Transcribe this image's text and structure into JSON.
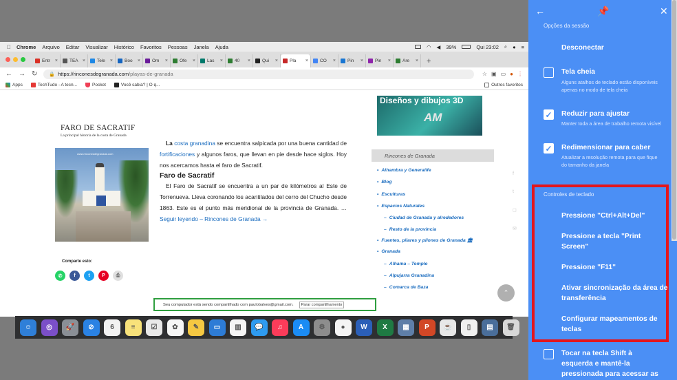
{
  "menubar": {
    "items": [
      "Chrome",
      "Arquivo",
      "Editar",
      "Visualizar",
      "Histórico",
      "Favoritos",
      "Pessoas",
      "Janela",
      "Ajuda"
    ],
    "battery": "39%",
    "clock": "Qui 23:02"
  },
  "tabs": [
    {
      "label": "Entr",
      "color": "#d93025"
    },
    {
      "label": "TEA",
      "color": "#555555"
    },
    {
      "label": "Tele",
      "color": "#1e88e5"
    },
    {
      "label": "Boo",
      "color": "#1565c0"
    },
    {
      "label": "Om",
      "color": "#6a1b9a"
    },
    {
      "label": "Ofe",
      "color": "#2e7d32"
    },
    {
      "label": "Las",
      "color": "#00796b"
    },
    {
      "label": "40",
      "color": "#2e7d32"
    },
    {
      "label": "Qui",
      "color": "#222222"
    },
    {
      "label": "Pla",
      "color": "#c62828"
    },
    {
      "label": "CO",
      "color": "#4285f4"
    },
    {
      "label": "Pin",
      "color": "#1976d2"
    },
    {
      "label": "Pin",
      "color": "#8e24aa"
    },
    {
      "label": "Áre",
      "color": "#2e7d32"
    }
  ],
  "url": {
    "host": "https://rinconesdegranada.com",
    "path": "/playas-de-granada"
  },
  "bookmarks": {
    "items": [
      "Apps",
      "TechTudo - A tecn...",
      "Pocket",
      "Você sabia? | O q..."
    ],
    "other": "Outros favoritos"
  },
  "article": {
    "title": "FARO DE SACRATIF",
    "subtitle": "La principal historia de la costa de Granada",
    "photo_caption": "www.rinconesdegranada.com",
    "p1_bold": "La",
    "p1_link1": "costa granadina",
    "p1_mid": " se encuentra salpicada por una buena cantidad de ",
    "p1_link2": "fortificaciones",
    "p1_end": " y algunos faros, que llevan en pie desde hace siglos. Hoy nos acercamos hasta el faro de Sacratif.",
    "heading": "Faro de Sacratif",
    "p2": "El Faro de Sacratif se encuentra a un par de kilómetros al Este de Torrenueva. Lleva coronando los acantilados del cerro del Chucho desde 1863. Este es el punto más meridional de la provincia de Granada. … ",
    "readmore": "Seguir leyendo – Rincones de Granada →",
    "share_label": "Comparte esto:"
  },
  "sidebar": {
    "banner": "Diseños y dibujos 3D",
    "banner_logo": "AM",
    "widget_title": "Rincones de Granada",
    "categories": [
      {
        "label": "Alhambra y Generalife",
        "sub": false
      },
      {
        "label": "Blog",
        "sub": false
      },
      {
        "label": "Esculturas",
        "sub": false
      },
      {
        "label": "Espacios Naturales",
        "sub": false
      },
      {
        "label": "Ciudad de Granada y alrededores",
        "sub": true
      },
      {
        "label": "Resto de la provincia",
        "sub": true
      },
      {
        "label": "Fuentes, pilares y pilones de Granada 🏛",
        "sub": false,
        "multi": true
      },
      {
        "label": "Granada",
        "sub": false
      },
      {
        "label": "Alhama – Temple",
        "sub": true
      },
      {
        "label": "Alpujarra Granadina",
        "sub": true
      },
      {
        "label": "Comarca de Baza",
        "sub": true
      }
    ]
  },
  "sharebar": {
    "text": "Seu computador está sendo compartilhado com paulobalves@gmail.com.",
    "stop": "Parar compartilhamento"
  },
  "dock": [
    {
      "color": "#2f7fd8",
      "g": "☺"
    },
    {
      "color": "#7b4fc9",
      "g": "◎"
    },
    {
      "color": "#8a8f96",
      "g": "🚀"
    },
    {
      "color": "#2a82e4",
      "g": "⊘"
    },
    {
      "color": "#f2f2f2",
      "g": "6"
    },
    {
      "color": "#f8e27a",
      "g": "≡"
    },
    {
      "color": "#e9e9e9",
      "g": "☑"
    },
    {
      "color": "#f6f6f6",
      "g": "✿"
    },
    {
      "color": "#f5c842",
      "g": "✎"
    },
    {
      "color": "#2d7cd6",
      "g": "▭"
    },
    {
      "color": "#f5f5f5",
      "g": "▥"
    },
    {
      "color": "#2e9bf0",
      "g": "💬"
    },
    {
      "color": "#fb3c5a",
      "g": "♫"
    },
    {
      "color": "#1b8cf4",
      "g": "A"
    },
    {
      "color": "#8d8d8d",
      "g": "⚙"
    },
    {
      "color": "#f4f4f4",
      "g": "●"
    },
    {
      "color": "#2b5fb8",
      "g": "W"
    },
    {
      "color": "#1f7a43",
      "g": "X"
    },
    {
      "color": "#5f7fa8",
      "g": "▦"
    },
    {
      "color": "#d24726",
      "g": "P"
    },
    {
      "color": "#e8e8e8",
      "g": "☕"
    },
    {
      "color": "#f0f0f0",
      "g": "▯"
    },
    {
      "color": "#4a6e9a",
      "g": "▤"
    },
    {
      "color": "#d8d8d8",
      "g": "🗑"
    }
  ],
  "panel": {
    "session_title": "Opções da sessão",
    "disconnect": "Desconectar",
    "fullscreen": {
      "label": "Tela cheia",
      "desc": "Alguns atalhos de teclado estão disponíveis apenas no modo de tela cheia",
      "checked": false
    },
    "shrink": {
      "label": "Reduzir para ajustar",
      "desc": "Manter toda a área de trabalho remota visível",
      "checked": true
    },
    "resize": {
      "label": "Redimensionar para caber",
      "desc": "Atualizar a resolução remota para que fique do tamanho da janela",
      "checked": true
    },
    "keyboard_title": "Controles de teclado",
    "ctrl_alt_del": "Pressione \"Ctrl+Alt+Del\"",
    "print_screen": "Pressione a tecla \"Print Screen\"",
    "f11": "Pressione \"F11\"",
    "clipboard": "Ativar sincronização da área de transferência",
    "mappings": "Configurar mapeamentos de teclas",
    "shift_option": "Tocar na tecla Shift à esquerda e mantê-la pressionada para acessar as"
  }
}
